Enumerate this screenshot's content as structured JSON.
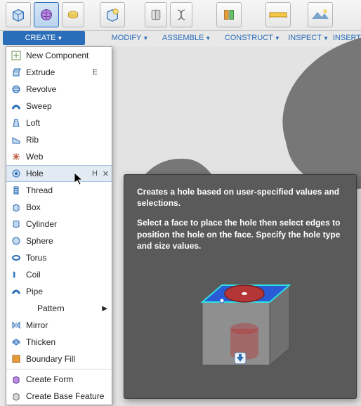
{
  "tabs": {
    "create": "CREATE",
    "modify": "MODIFY",
    "assemble": "ASSEMBLE",
    "construct": "CONSTRUCT",
    "inspect": "INSPECT",
    "insert": "INSERT"
  },
  "menu": {
    "new_component": "New Component",
    "extrude": "Extrude",
    "extrude_key": "E",
    "revolve": "Revolve",
    "sweep": "Sweep",
    "loft": "Loft",
    "rib": "Rib",
    "web": "Web",
    "hole": "Hole",
    "hole_key": "H",
    "hole_close": "✕",
    "thread": "Thread",
    "box": "Box",
    "cylinder": "Cylinder",
    "sphere": "Sphere",
    "torus": "Torus",
    "coil": "Coil",
    "pipe": "Pipe",
    "pattern": "Pattern",
    "mirror": "Mirror",
    "thicken": "Thicken",
    "boundary_fill": "Boundary Fill",
    "create_form": "Create Form",
    "create_base_feature": "Create Base Feature"
  },
  "tooltip": {
    "line1": "Creates a hole based on user-specified values and selections.",
    "line2": "Select a face to place the hole then select edges to position the hole on the face. Specify the hole type and size values."
  }
}
